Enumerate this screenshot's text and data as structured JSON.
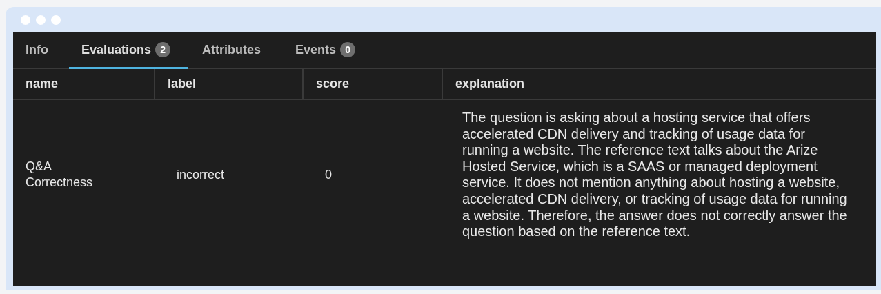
{
  "tabs": [
    {
      "label": "Info",
      "selected": false
    },
    {
      "label": "Evaluations",
      "badge": "2",
      "selected": true
    },
    {
      "label": "Attributes",
      "selected": false
    },
    {
      "label": "Events",
      "badge": "0",
      "selected": false
    }
  ],
  "table": {
    "columns": [
      "name",
      "label",
      "score",
      "explanation"
    ],
    "rows": [
      [
        "Q&A Correctness",
        "incorrect",
        "0",
        "The question is asking about a hosting service that offers accelerated CDN delivery and tracking of usage data for running a website. The reference text talks about the Arize Hosted Service, which is a SAAS or managed deployment service. It does not mention anything about hosting a website, accelerated CDN delivery, or tracking of usage data for running a website. Therefore, the answer does not correctly answer the question based on the reference text."
      ]
    ]
  }
}
